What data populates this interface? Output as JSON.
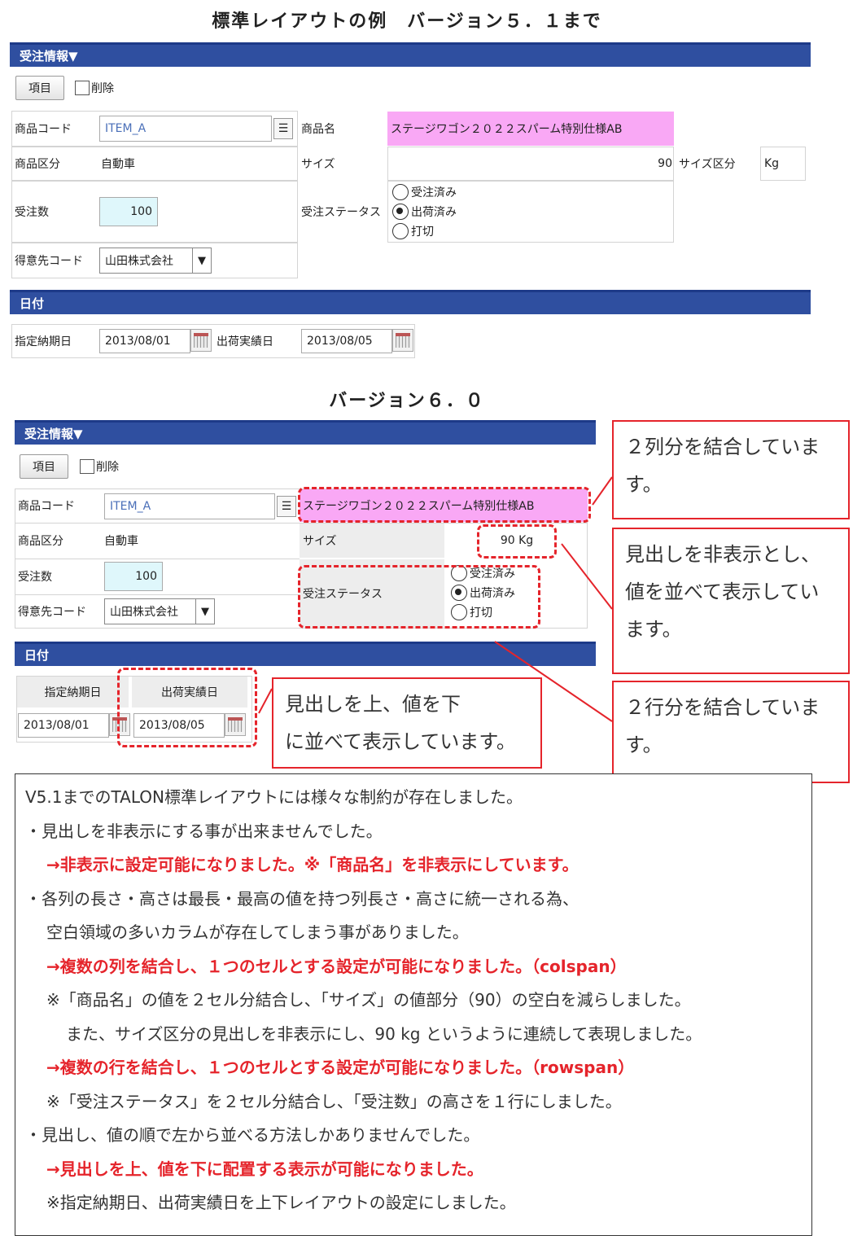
{
  "v51": {
    "title": "標準レイアウトの例　バージョン５．１まで",
    "order_header": "受注情報▼",
    "item_button": "項目",
    "delete_label": "削除",
    "product_code_label": "商品コード",
    "product_code_value": "ITEM_A",
    "product_name_label": "商品名",
    "product_name_value": "ステージワゴン２０２２スパーム特別仕様AB",
    "category_label": "商品区分",
    "category_value": "自動車",
    "size_label": "サイズ",
    "size_value": "90",
    "size_unit_label": "サイズ区分",
    "size_unit_value": "Kg",
    "qty_label": "受注数",
    "qty_value": "100",
    "status_label": "受注ステータス",
    "status_options": [
      "受注済み",
      "出荷済み",
      "打切"
    ],
    "status_selected": "出荷済み",
    "customer_label": "得意先コード",
    "customer_value": "山田株式会社",
    "date_header": "日付",
    "due_date_label": "指定納期日",
    "due_date_value": "2013/08/01",
    "ship_date_label": "出荷実績日",
    "ship_date_value": "2013/08/05"
  },
  "v60": {
    "title": "バージョン６．０",
    "order_header": "受注情報▼",
    "item_button": "項目",
    "delete_label": "削除",
    "product_code_label": "商品コード",
    "product_code_value": "ITEM_A",
    "product_name_value": "ステージワゴン２０２２スパーム特別仕様AB",
    "category_label": "商品区分",
    "category_value": "自動車",
    "size_label": "サイズ",
    "size_value": "90 Kg",
    "qty_label": "受注数",
    "qty_value": "100",
    "status_label": "受注ステータス",
    "status_options": [
      "受注済み",
      "出荷済み",
      "打切"
    ],
    "status_selected": "出荷済み",
    "customer_label": "得意先コード",
    "customer_value": "山田株式会社",
    "date_header": "日付",
    "due_date_label": "指定納期日",
    "due_date_value": "2013/08/01",
    "ship_date_label": "出荷実績日",
    "ship_date_value": "2013/08/05"
  },
  "callouts": {
    "colspan_line1": "２列分を結合していま",
    "colspan_line2": "す。",
    "hidden_line1": "見出しを非表示とし、",
    "hidden_line2": "値を並べて表示してい",
    "hidden_line3": "ます。",
    "rowspan_line1": "２行分を結合していま",
    "rowspan_line2": "す。",
    "vertical_line1": "見出しを上、値を下",
    "vertical_line2": "に並べて表示しています。"
  },
  "notes": [
    "V5.1までのTALON標準レイアウトには様々な制約が存在しました。",
    "・見出しを非表示にする事が出来ませんでした。",
    "→非表示に設定可能になりました。※「商品名」を非表示にしています。",
    "・各列の長さ・高さは最長・最高の値を持つ列長さ・高さに統一される為、",
    "空白領域の多いカラムが存在してしまう事がありました。",
    "→複数の列を結合し、１つのセルとする設定が可能になりました。（colspan）",
    "※「商品名」の値を２セル分結合し、「サイズ」の値部分（90）の空白を減らしました。",
    "また、サイズ区分の見出しを非表示にし、90 kg というように連続して表現しました。",
    "→複数の行を結合し、１つのセルとする設定が可能になりました。（rowspan）",
    "※「受注ステータス」を２セル分結合し、「受注数」の高さを１行にしました。",
    "・見出し、値の順で左から並べる方法しかありませんでした。",
    "→見出しを上、値を下に配置する表示が可能になりました。",
    "※指定納期日、出荷実績日を上下レイアウトの設定にしました。"
  ],
  "colors": {
    "header_blue": "#2f4fa0",
    "highlight_pink": "#f9a8f5",
    "qty_cyan": "#dff7fb",
    "accent_red": "#e5242b"
  }
}
